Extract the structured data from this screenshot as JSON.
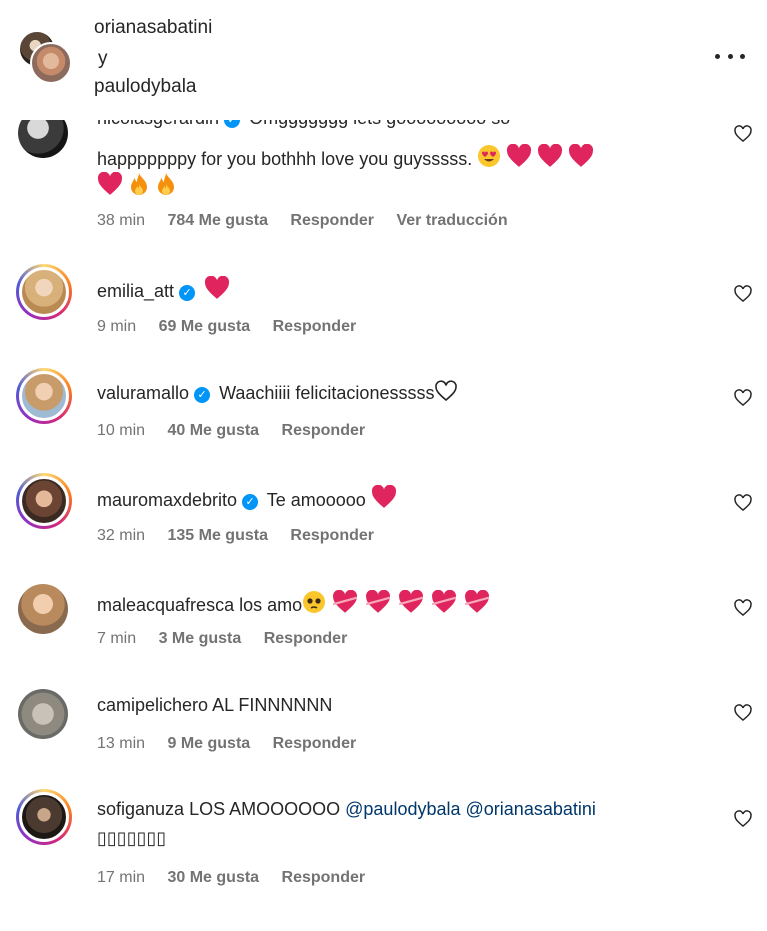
{
  "header": {
    "user1": "orianasabatini",
    "connector": "y",
    "user2": "paulodybala"
  },
  "comments": [
    {
      "username": "nicolasgerardin",
      "text_top_cut": "Omggggggg lets gooooooooo so",
      "text_line2": "happpppppy for you bothhh love you guysssss.",
      "time": "38 min",
      "likes": "784 Me gusta",
      "reply": "Responder",
      "translate": "Ver traducción"
    },
    {
      "username": "emilia_att",
      "text": "",
      "time": "9 min",
      "likes": "69 Me gusta",
      "reply": "Responder"
    },
    {
      "username": "valuramallo",
      "text": "Waachiiii felicitacionesssss",
      "time": "10 min",
      "likes": "40 Me gusta",
      "reply": "Responder"
    },
    {
      "username": "mauromaxdebrito",
      "text": "Te amooooo",
      "time": "32 min",
      "likes": "135 Me gusta",
      "reply": "Responder"
    },
    {
      "username": "maleacquafresca",
      "text": "los amo",
      "time": "7 min",
      "likes": "3 Me gusta",
      "reply": "Responder"
    },
    {
      "username": "camipelichero",
      "text": "AL FINNNNNN",
      "time": "13 min",
      "likes": "9 Me gusta",
      "reply": "Responder"
    },
    {
      "username": "sofiganuza",
      "text": "LOS AMOOOOOO",
      "mention1": "@paulodybala",
      "mention2": "@orianasabatini",
      "text_line2": "▯▯▯▯▯▯▯",
      "time": "17 min",
      "likes": "30 Me gusta",
      "reply": "Responder"
    }
  ],
  "icons": {
    "more": "more-options-icon",
    "like": "heart-outline-icon",
    "verified": "verified-badge-icon"
  },
  "colors": {
    "verified_blue": "#0095f6",
    "heart_red": "#e0245e",
    "mention_blue": "#00376b",
    "meta_gray": "#737373"
  }
}
